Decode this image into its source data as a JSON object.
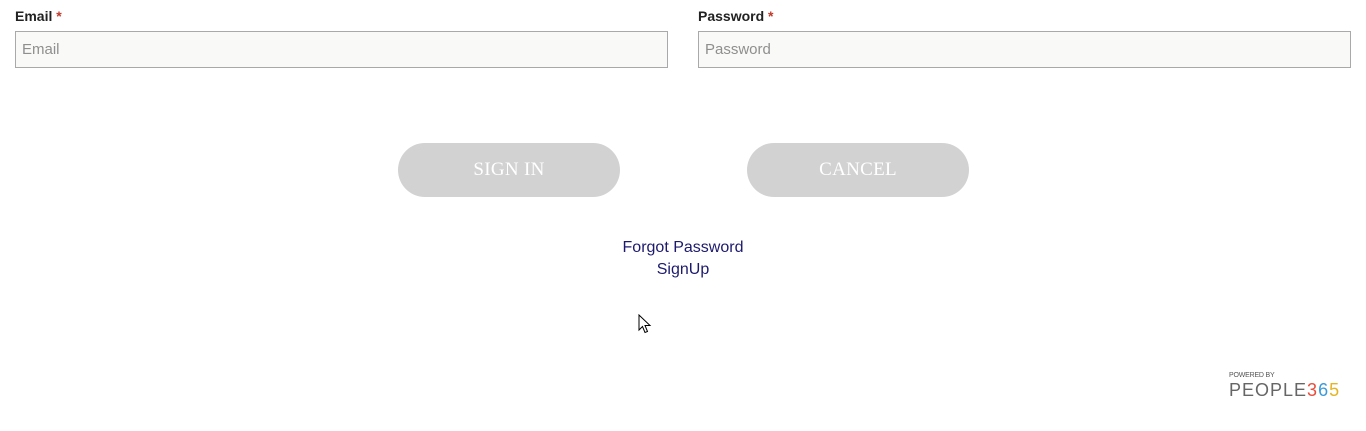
{
  "form": {
    "email": {
      "label": "Email",
      "required_mark": "*",
      "placeholder": "Email",
      "value": ""
    },
    "password": {
      "label": "Password",
      "required_mark": "*",
      "placeholder": "Password",
      "value": ""
    }
  },
  "buttons": {
    "sign_in": "SIGN IN",
    "cancel": "CANCEL"
  },
  "links": {
    "forgot_password": "Forgot Password",
    "sign_up": "SignUp"
  },
  "footer": {
    "powered_by": "POWERED BY",
    "brand_text": "PEOPLE",
    "brand_digit_1": "3",
    "brand_digit_2": "6",
    "brand_digit_3": "5"
  },
  "colors": {
    "button_bg": "#d2d2d2",
    "link": "#1d1a6e",
    "input_bg": "#f9f9f7"
  }
}
